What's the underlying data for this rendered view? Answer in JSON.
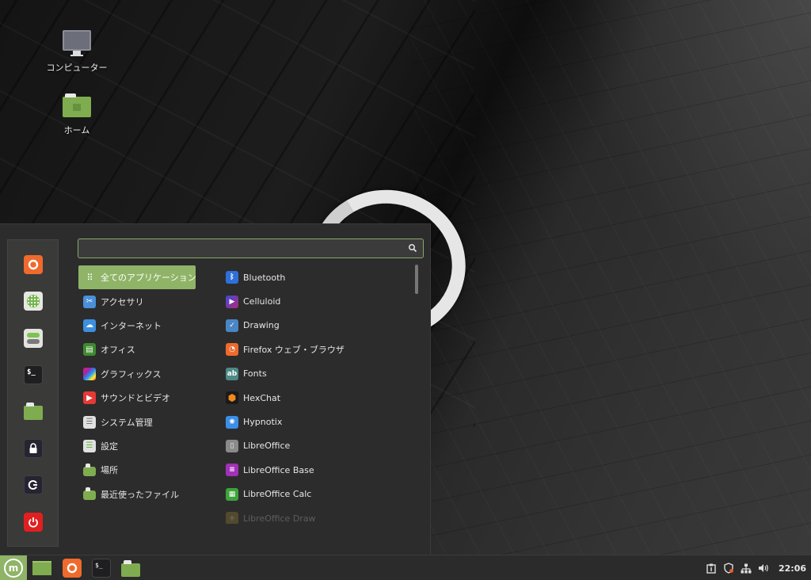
{
  "desktop": {
    "icons": [
      {
        "label": "コンピューター",
        "icon": "computer-icon"
      },
      {
        "label": "ホーム",
        "icon": "home-folder-icon"
      }
    ]
  },
  "menu": {
    "search": {
      "value": "",
      "placeholder": ""
    },
    "favorites": [
      {
        "name": "Firefox",
        "icon": "firefox-icon"
      },
      {
        "name": "Software Manager",
        "icon": "software-manager-icon"
      },
      {
        "name": "System Settings",
        "icon": "settings-icon"
      },
      {
        "name": "Terminal",
        "icon": "terminal-icon"
      },
      {
        "name": "Files",
        "icon": "folder-icon"
      },
      {
        "name": "Lock Screen",
        "icon": "lock-icon"
      },
      {
        "name": "Logout",
        "icon": "logout-icon"
      },
      {
        "name": "Quit",
        "icon": "power-icon"
      }
    ],
    "categories": [
      {
        "label": "全てのアプリケーション",
        "icon": "grid-icon",
        "active": true
      },
      {
        "label": "アクセサリ",
        "icon": "accessories-icon"
      },
      {
        "label": "インターネット",
        "icon": "internet-icon"
      },
      {
        "label": "オフィス",
        "icon": "office-icon"
      },
      {
        "label": "グラフィックス",
        "icon": "graphics-icon"
      },
      {
        "label": "サウンドとビデオ",
        "icon": "sound-video-icon"
      },
      {
        "label": "システム管理",
        "icon": "system-admin-icon"
      },
      {
        "label": "設定",
        "icon": "settings-icon"
      },
      {
        "label": "場所",
        "icon": "places-icon"
      },
      {
        "label": "最近使ったファイル",
        "icon": "recent-files-icon"
      }
    ],
    "applications": [
      {
        "label": "Bluetooth",
        "icon": "bluetooth-icon"
      },
      {
        "label": "Celluloid",
        "icon": "celluloid-icon"
      },
      {
        "label": "Drawing",
        "icon": "drawing-icon"
      },
      {
        "label": "Firefox ウェブ・ブラウザ",
        "icon": "firefox-icon"
      },
      {
        "label": "Fonts",
        "icon": "fonts-icon"
      },
      {
        "label": "HexChat",
        "icon": "hexchat-icon"
      },
      {
        "label": "Hypnotix",
        "icon": "hypnotix-icon"
      },
      {
        "label": "LibreOffice",
        "icon": "libreoffice-icon"
      },
      {
        "label": "LibreOffice Base",
        "icon": "libreoffice-base-icon"
      },
      {
        "label": "LibreOffice Calc",
        "icon": "libreoffice-calc-icon"
      },
      {
        "label": "LibreOffice Draw",
        "icon": "libreoffice-draw-icon"
      }
    ]
  },
  "taskbar": {
    "launchers": [
      {
        "name": "Show Desktop",
        "icon": "show-desktop-icon"
      },
      {
        "name": "Firefox",
        "icon": "firefox-icon"
      },
      {
        "name": "Terminal",
        "icon": "terminal-icon",
        "glyph": "$_"
      },
      {
        "name": "Files",
        "icon": "folder-icon"
      }
    ],
    "tray": {
      "icons": [
        "update-manager-icon",
        "shield-icon",
        "network-icon",
        "volume-icon"
      ],
      "clock": "22:06"
    }
  },
  "colors": {
    "accent": "#8fb467",
    "panel": "#2c2c2c",
    "search_border": "#89a86a"
  }
}
